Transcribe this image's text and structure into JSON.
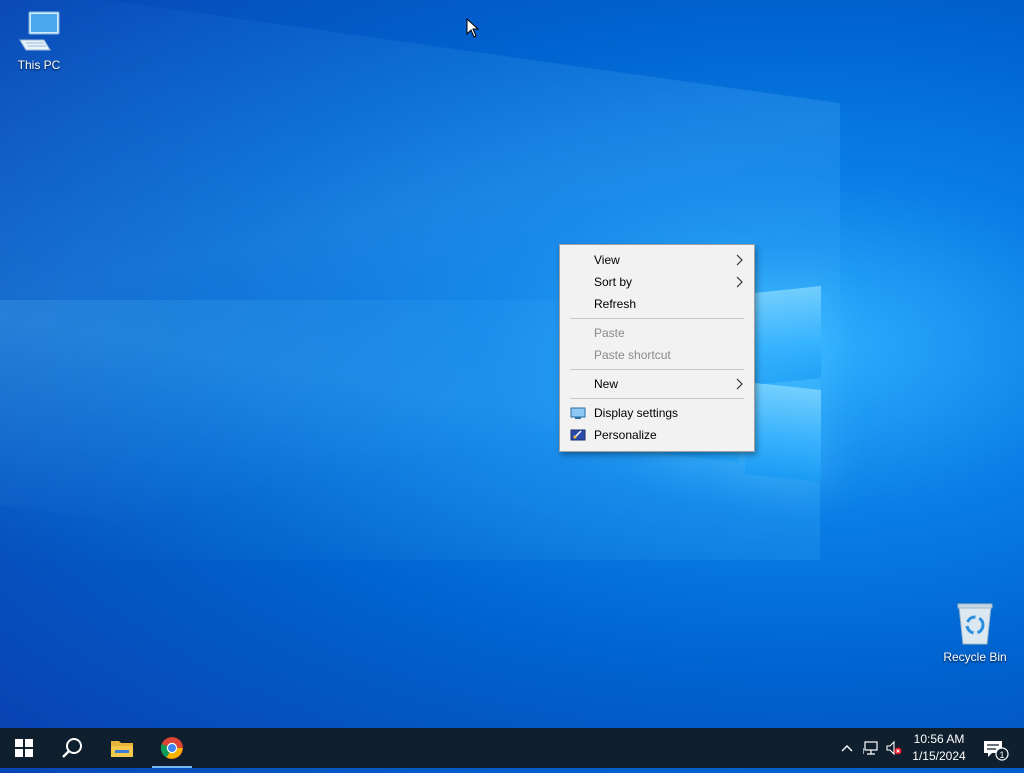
{
  "desktop": {
    "icons": [
      {
        "label": "This PC"
      },
      {
        "label": "Recycle Bin"
      }
    ]
  },
  "context_menu": {
    "items": [
      {
        "label": "View",
        "submenu": true,
        "enabled": true
      },
      {
        "label": "Sort by",
        "submenu": true,
        "enabled": true
      },
      {
        "label": "Refresh",
        "submenu": false,
        "enabled": true
      },
      {
        "label": "Paste",
        "submenu": false,
        "enabled": false
      },
      {
        "label": "Paste shortcut",
        "submenu": false,
        "enabled": false
      },
      {
        "label": "New",
        "submenu": true,
        "enabled": true
      },
      {
        "label": "Display settings",
        "submenu": false,
        "enabled": true,
        "icon": "display-icon"
      },
      {
        "label": "Personalize",
        "submenu": false,
        "enabled": true,
        "icon": "personalize-icon"
      }
    ]
  },
  "taskbar": {
    "buttons": [
      "start-icon",
      "search-icon",
      "file-explorer-icon",
      "chrome-icon"
    ],
    "tray": {
      "icons": [
        "chevron-up-icon",
        "network-icon",
        "volume-muted-icon"
      ],
      "time": "10:56 AM",
      "date": "1/15/2024",
      "notification_count": "1"
    }
  },
  "colors": {
    "taskbar_bg": "#0f1f2e",
    "menu_bg": "#f2f2f2",
    "active_indicator": "#76b9ed"
  }
}
